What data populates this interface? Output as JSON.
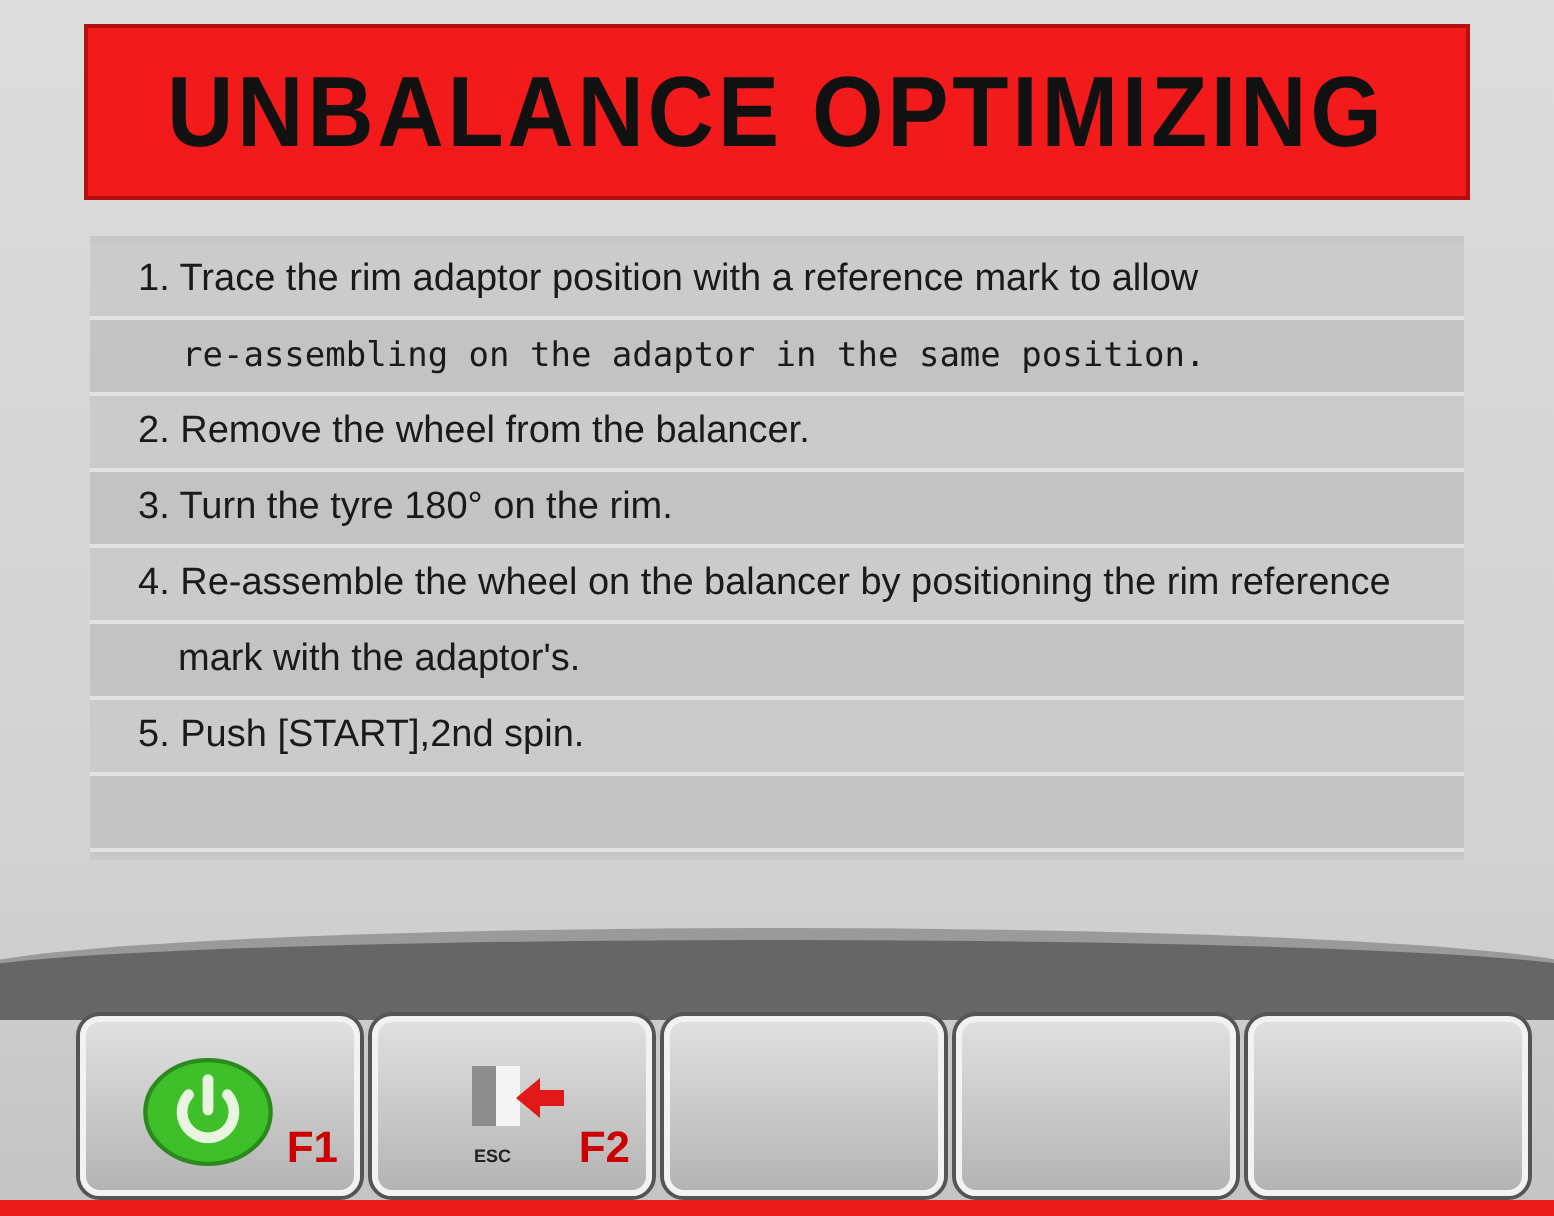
{
  "title": "UNBALANCE OPTIMIZING",
  "steps": [
    {
      "kind": "normal",
      "text": "1. Trace the rim adaptor position with a reference mark to allow"
    },
    {
      "kind": "mono",
      "text": "re-assembling on the adaptor in the same position."
    },
    {
      "kind": "normal",
      "text": "2. Remove the wheel from the balancer."
    },
    {
      "kind": "normal",
      "text": "3. Turn the tyre 180° on the rim."
    },
    {
      "kind": "normal",
      "text": "4. Re-assemble the wheel on the balancer by positioning the rim reference"
    },
    {
      "kind": "continued",
      "text": "mark with the adaptor's."
    },
    {
      "kind": "normal",
      "text": "5. Push [START],2nd spin."
    }
  ],
  "softkeys": [
    {
      "kind": "power",
      "key": "F1"
    },
    {
      "kind": "esc",
      "key": "F2",
      "icon_text": "ESC"
    },
    {
      "kind": "blank"
    },
    {
      "kind": "blank"
    },
    {
      "kind": "blank"
    }
  ]
}
